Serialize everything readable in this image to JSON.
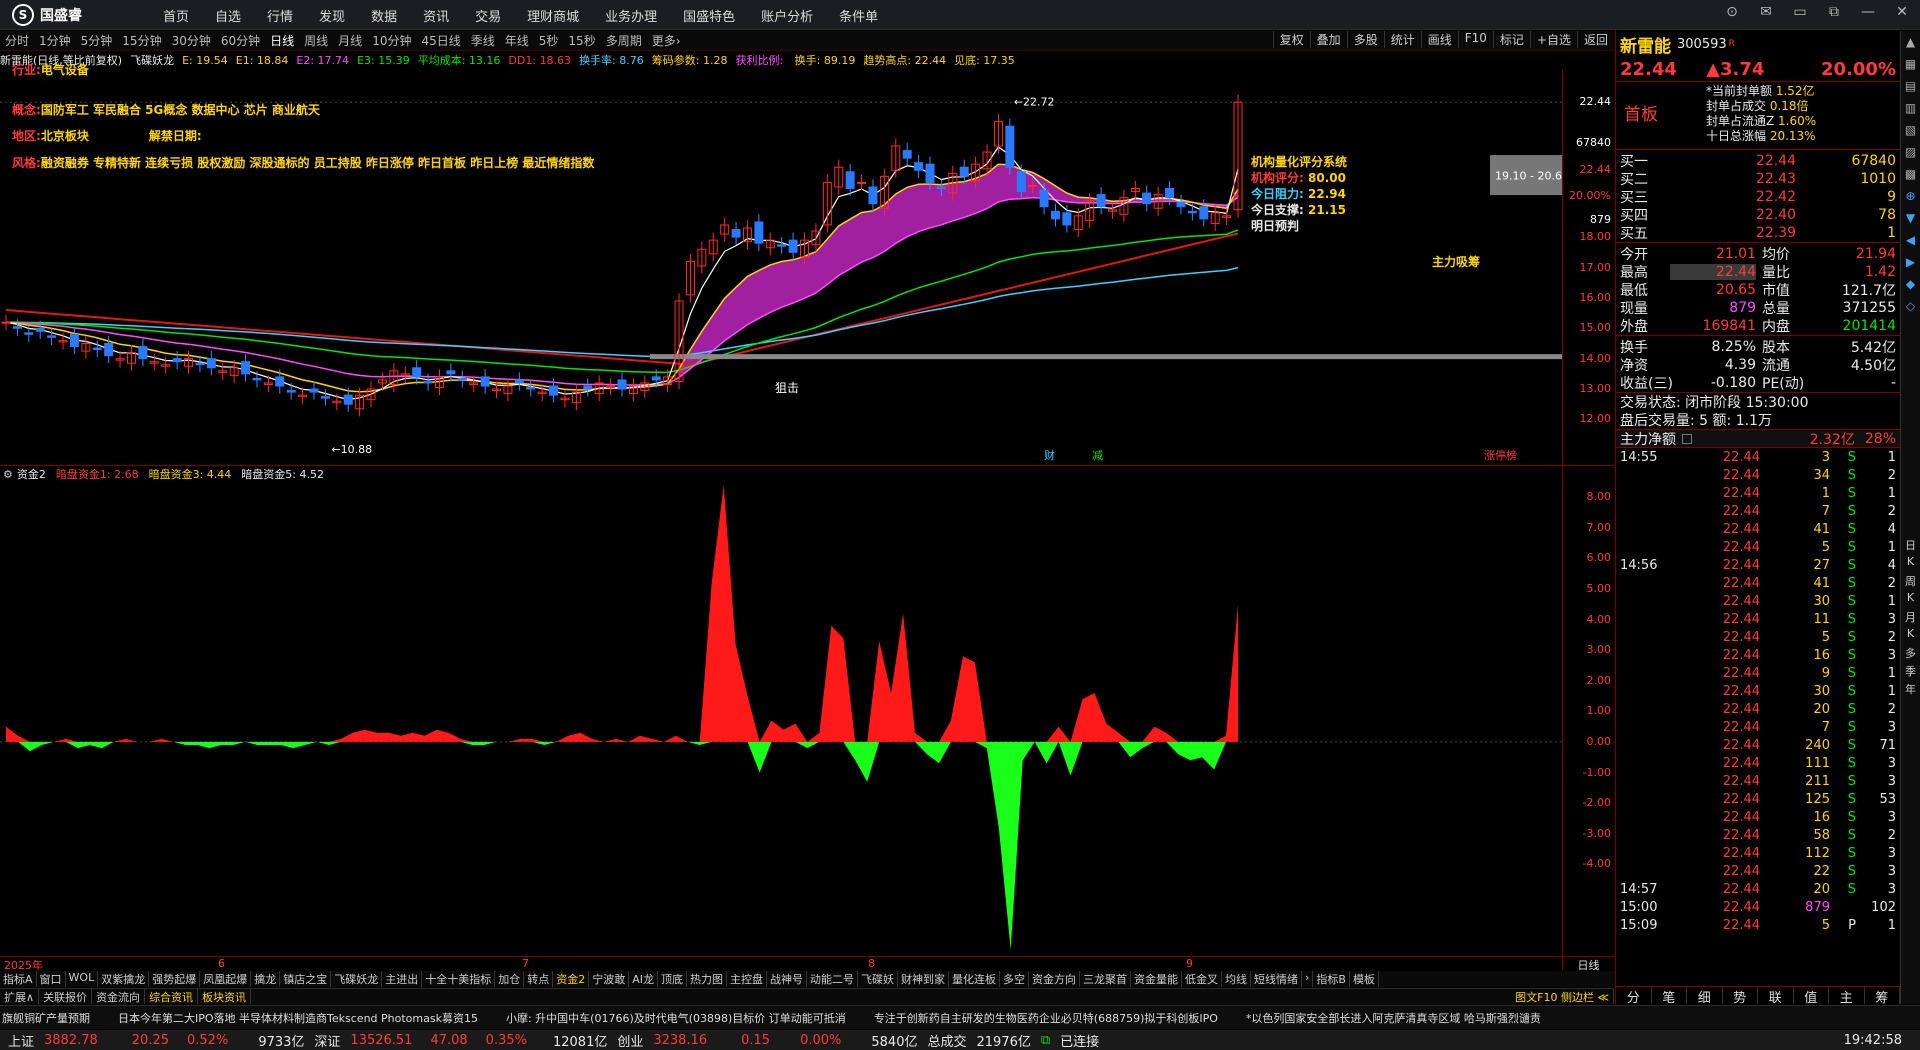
{
  "app": {
    "logo_text": "国盛睿"
  },
  "nav": [
    "首页",
    "自选",
    "行情",
    "发现",
    "数据",
    "资讯",
    "交易",
    "理财商城",
    "业务办理",
    "国盛特色",
    "账户分析",
    "条件单"
  ],
  "window_buttons": [
    "⊙",
    "✉",
    "▭",
    "⧉",
    "—",
    "✕"
  ],
  "periods": [
    "分时",
    "1分钟",
    "5分钟",
    "15分钟",
    "30分钟",
    "60分钟",
    "日线",
    "周线",
    "月线",
    "10分钟",
    "45日线",
    "季线",
    "年线",
    "5秒",
    "15秒",
    "多周期",
    "更多›"
  ],
  "active_period": "日线",
  "toolbar_right": [
    "复权",
    "叠加",
    "多股",
    "统计",
    "画线",
    "F10",
    "标记",
    "+自选",
    "返回"
  ],
  "indicator_header": [
    {
      "t": "新雷能(日线,等比前复权)",
      "c": "#e8e8e8"
    },
    {
      "t": "飞碟妖龙",
      "c": "#e8e8e8"
    },
    {
      "t": "E: 19.54",
      "c": "#ffd400"
    },
    {
      "t": "E1: 18.84",
      "c": "#ffd400"
    },
    {
      "t": "E2: 17.74",
      "c": "#ff4dff"
    },
    {
      "t": "E3: 15.39",
      "c": "#00e600"
    },
    {
      "t": "平均成本: 13.16",
      "c": "#00e600"
    },
    {
      "t": "DD1: 18.63",
      "c": "#ff3b3b"
    },
    {
      "t": "换手率: 8.76",
      "c": "#40d0ff"
    },
    {
      "t": "筹码参数: 1.28",
      "c": "#ffd400"
    },
    {
      "t": "获利比例: ",
      "c": "#ff4dff"
    },
    {
      "t": "换手: 89.19",
      "c": "#ffd400"
    },
    {
      "t": "趋势高点: 22.44",
      "c": "#ffd400"
    },
    {
      "t": "见底: 17.35",
      "c": "#ffd400"
    }
  ],
  "info_lines": [
    {
      "k": "行业:",
      "v": "电气设备"
    },
    {
      "k": "概念:",
      "v": "国防军工 军民融合 5G概念 数据中心 芯片 商业航天"
    },
    {
      "k": "地区:",
      "v": "北京板块",
      "k2": "解禁日期:",
      "v2": ""
    },
    {
      "k": "风格:",
      "v": "融资融券 专精特新 连续亏损 股权激励 深股通标的 员工持股 昨日涨停 昨日首板 昨日上榜 最近情绪指数"
    }
  ],
  "score_box": {
    "title": "机构量化评分系统",
    "rows": [
      {
        "k": "机构评分:",
        "v": "80.00"
      },
      {
        "k": "今日阻力:",
        "v": "22.94"
      },
      {
        "k": "今日支撑:",
        "v": "21.15"
      },
      {
        "k": "明日预判",
        "v": ""
      }
    ]
  },
  "chart_labels": {
    "high": "22.72",
    "low": "10.88",
    "range": "19.10 - 20.6",
    "main_buy": "主力吸筹",
    "strike": "狙击",
    "bottom_tags": [
      "财",
      "减",
      "涨停榜"
    ]
  },
  "price_axis": [
    "22.44",
    "67840",
    "22.44",
    "20.00%",
    "879",
    "18.00",
    "17.00",
    "16.00",
    "15.00",
    "14.00",
    "13.00",
    "12.00"
  ],
  "sub_header": [
    {
      "t": "资金2",
      "c": "#e8e8e8"
    },
    {
      "t": "暗盘资金1: 2.68",
      "c": "#ff3b3b"
    },
    {
      "t": "暗盘资金3: 4.44",
      "c": "#ffd400"
    },
    {
      "t": "暗盘资金5: 4.52",
      "c": "#e8e8e8"
    }
  ],
  "sub_axis": [
    "8.00",
    "7.00",
    "6.00",
    "5.00",
    "4.00",
    "3.00",
    "2.00",
    "1.00",
    "0.00",
    "-1.00",
    "-2.00",
    "-3.00",
    "-4.00"
  ],
  "dates": [
    "2025年",
    "6",
    "7",
    "8",
    "9"
  ],
  "right_bottom_label": "日线",
  "indicator_tabs": [
    "指标A",
    "窗口",
    "WOL",
    "双紫擒龙",
    "强势起爆",
    "凤凰起爆",
    "擒龙",
    "镇店之宝",
    "飞碟妖龙",
    "主进出",
    "十全十美指标",
    "加仓",
    "转点",
    "资金2",
    "宁波敢",
    "AI龙",
    "顶底",
    "热力图",
    "主控盘",
    "战神号",
    "动能二号",
    "飞碟妖",
    "财神到家",
    "量化连板",
    "多空",
    "资金方向",
    "三龙聚首",
    "资金量能",
    "低金叉",
    "均线",
    "短线情绪",
    "›",
    "指标B",
    "模板"
  ],
  "active_tab": "资金2",
  "sub_tabs": [
    "扩展∧",
    "关联报价",
    "资金流向",
    "综合资讯",
    "板块资讯"
  ],
  "sub_tabs_right": "图文F10 侧边栏 ≪",
  "ticker": [
    "旗舰铜矿产量预期",
    "日本今年第二大IPO落地 半导体材料制造商Tekscend Photomask募资15",
    "小摩: 升中国中车(01766)及时代电气(03898)目标价 订单动能可抵消",
    "专注于创新药自主研发的生物医药企业必贝特(688759)拟于科创板IPO",
    "*以色列国家安全部长进入阿克萨清真寺区域 哈马斯强烈谴责"
  ],
  "status": {
    "sh_label": "上证",
    "sh": "3882.78",
    "sh_chg": "20.25",
    "sh_pct": "0.52%",
    "sh_amt": "9733亿",
    "sz_label": "深证",
    "sz": "13526.51",
    "sz_chg": "47.08",
    "sz_pct": "0.35%",
    "sz_amt": "12081亿",
    "cy_label": "创业",
    "cy": "3238.16",
    "cy_chg": "0.15",
    "cy_pct": "0.00%",
    "cy_amt": "5840亿",
    "total_label": "总成交",
    "total": "21976亿",
    "conn": "已连接",
    "time": "19:42:58"
  },
  "quote": {
    "name": "新雷能",
    "code": "300593",
    "badge": "R",
    "price": "22.44",
    "change": "▲3.74",
    "pct": "20.00%",
    "board": "首板",
    "seal_rows": [
      {
        "k": "*当前封单额",
        "v": "1.52亿"
      },
      {
        "k": "封单占成交",
        "v": "0.18倍"
      },
      {
        "k": "封单占流通Z",
        "v": "1.60%"
      },
      {
        "k": "十日总涨幅",
        "v": "20.13%"
      }
    ],
    "bids": [
      {
        "k": "买一",
        "p": "22.44",
        "v": "67840"
      },
      {
        "k": "买二",
        "p": "22.43",
        "v": "1010"
      },
      {
        "k": "买三",
        "p": "22.42",
        "v": "9"
      },
      {
        "k": "买四",
        "p": "22.40",
        "v": "78"
      },
      {
        "k": "买五",
        "p": "22.39",
        "v": "1"
      }
    ],
    "stats": [
      {
        "k1": "今开",
        "v1": "21.01",
        "c1": "red",
        "k2": "均价",
        "v2": "21.94",
        "c2": "red"
      },
      {
        "k1": "最高",
        "v1": "22.44",
        "c1": "red",
        "k2": "量比",
        "v2": "1.42",
        "c2": "red"
      },
      {
        "k1": "最低",
        "v1": "20.65",
        "c1": "red",
        "k2": "市值",
        "v2": "121.7亿",
        "c2": "wht"
      },
      {
        "k1": "现量",
        "v1": "879",
        "c1": "mag",
        "k2": "总量",
        "v2": "371255",
        "c2": "wht"
      },
      {
        "k1": "外盘",
        "v1": "169841",
        "c1": "red",
        "k2": "内盘",
        "v2": "201414",
        "c2": "grn"
      }
    ],
    "stats2": [
      {
        "k1": "换手",
        "v1": "8.25%",
        "k2": "股本",
        "v2": "5.42亿"
      },
      {
        "k1": "净资",
        "v1": "4.39",
        "k2": "流通",
        "v2": "4.50亿"
      },
      {
        "k1": "收益(三)",
        "v1": "-0.180",
        "k2": "PE(动)",
        "v2": "-"
      }
    ],
    "trade_status": "交易状态: 闭市阶段 15:30:00",
    "after_hours": "盘后交易量: 5  额: 1.1万",
    "net_label": "主力净额",
    "net_value": "2.32亿",
    "net_pct": "28%"
  },
  "ticks": [
    {
      "t": "14:55",
      "p": "22.44",
      "v": "3",
      "c": "S",
      "n": "1"
    },
    {
      "t": "",
      "p": "22.44",
      "v": "34",
      "c": "S",
      "n": "2"
    },
    {
      "t": "",
      "p": "22.44",
      "v": "1",
      "c": "S",
      "n": "1"
    },
    {
      "t": "",
      "p": "22.44",
      "v": "7",
      "c": "S",
      "n": "2"
    },
    {
      "t": "",
      "p": "22.44",
      "v": "41",
      "c": "S",
      "n": "4"
    },
    {
      "t": "",
      "p": "22.44",
      "v": "5",
      "c": "S",
      "n": "1"
    },
    {
      "t": "14:56",
      "p": "22.44",
      "v": "27",
      "c": "S",
      "n": "4"
    },
    {
      "t": "",
      "p": "22.44",
      "v": "41",
      "c": "S",
      "n": "2"
    },
    {
      "t": "",
      "p": "22.44",
      "v": "30",
      "c": "S",
      "n": "1"
    },
    {
      "t": "",
      "p": "22.44",
      "v": "11",
      "c": "S",
      "n": "3"
    },
    {
      "t": "",
      "p": "22.44",
      "v": "5",
      "c": "S",
      "n": "2"
    },
    {
      "t": "",
      "p": "22.44",
      "v": "16",
      "c": "S",
      "n": "3"
    },
    {
      "t": "",
      "p": "22.44",
      "v": "9",
      "c": "S",
      "n": "1"
    },
    {
      "t": "",
      "p": "22.44",
      "v": "30",
      "c": "S",
      "n": "1"
    },
    {
      "t": "",
      "p": "22.44",
      "v": "20",
      "c": "S",
      "n": "2"
    },
    {
      "t": "",
      "p": "22.44",
      "v": "7",
      "c": "S",
      "n": "3"
    },
    {
      "t": "",
      "p": "22.44",
      "v": "240",
      "c": "S",
      "n": "71"
    },
    {
      "t": "",
      "p": "22.44",
      "v": "111",
      "c": "S",
      "n": "3"
    },
    {
      "t": "",
      "p": "22.44",
      "v": "211",
      "c": "S",
      "n": "3"
    },
    {
      "t": "",
      "p": "22.44",
      "v": "125",
      "c": "S",
      "n": "53"
    },
    {
      "t": "",
      "p": "22.44",
      "v": "16",
      "c": "S",
      "n": "3"
    },
    {
      "t": "",
      "p": "22.44",
      "v": "58",
      "c": "S",
      "n": "2"
    },
    {
      "t": "",
      "p": "22.44",
      "v": "112",
      "c": "S",
      "n": "3"
    },
    {
      "t": "",
      "p": "22.44",
      "v": "22",
      "c": "S",
      "n": "3"
    },
    {
      "t": "14:57",
      "p": "22.44",
      "v": "20",
      "c": "S",
      "n": "3"
    },
    {
      "t": "15:00",
      "p": "22.44",
      "v": "879",
      "c": "",
      "n": "102"
    },
    {
      "t": "15:09",
      "p": "22.44",
      "v": "5",
      "c": "P",
      "n": "1"
    }
  ],
  "bottom_tabs": [
    "分",
    "笔",
    "细",
    "势",
    "联",
    "值",
    "主",
    "筹"
  ],
  "sidebar_tools": [
    "▲",
    "▦",
    "▤",
    "▥",
    "▧",
    "▨",
    "▩",
    "⊕",
    "▼",
    "◀",
    "▶",
    "◆",
    "◇"
  ],
  "sidebar_text": [
    "日",
    "K",
    "周",
    "K",
    "月",
    "K",
    "多",
    "季",
    "年"
  ],
  "chart_data": {
    "type": "candlestick",
    "price_ylim": [
      10.5,
      23.5
    ],
    "close": [
      15.2,
      15.0,
      14.8,
      14.9,
      14.7,
      14.6,
      14.4,
      14.5,
      14.3,
      14.1,
      14.0,
      14.2,
      14.0,
      13.9,
      13.8,
      13.9,
      14.0,
      13.8,
      13.7,
      13.6,
      13.7,
      13.5,
      13.3,
      13.2,
      13.1,
      12.9,
      12.8,
      12.9,
      12.7,
      12.6,
      12.5,
      12.8,
      13.0,
      13.3,
      13.6,
      13.5,
      13.4,
      13.2,
      13.4,
      13.5,
      13.3,
      13.2,
      13.1,
      13.0,
      13.1,
      13.2,
      13.0,
      12.9,
      12.8,
      12.7,
      12.9,
      13.0,
      13.2,
      13.1,
      13.0,
      13.1,
      13.2,
      13.3,
      13.4,
      15.9,
      17.2,
      17.6,
      17.9,
      18.4,
      18.0,
      18.3,
      17.8,
      17.9,
      17.7,
      17.5,
      17.9,
      18.2,
      19.8,
      20.3,
      19.6,
      19.8,
      19.1,
      20.0,
      21.0,
      20.6,
      20.2,
      19.8,
      19.6,
      20.1,
      20.0,
      20.4,
      20.8,
      21.8,
      20.3,
      19.5,
      19.7,
      19.0,
      18.6,
      18.4,
      18.7,
      19.2,
      19.0,
      18.9,
      19.3,
      19.6,
      19.1,
      19.4,
      19.3,
      19.0,
      18.8,
      18.6,
      18.8,
      18.7,
      22.44
    ],
    "series_lines": [
      {
        "name": "E",
        "color": "#ffffff"
      },
      {
        "name": "E1",
        "color": "#ffd400"
      },
      {
        "name": "E2",
        "color": "#ff4dff"
      },
      {
        "name": "E3",
        "color": "#00e600"
      },
      {
        "name": "平均成本",
        "color": "#40d0ff"
      },
      {
        "name": "DD1",
        "color": "#ff2020"
      }
    ],
    "sub_ylim": [
      -7,
      8.5
    ],
    "sub_values": [
      0.5,
      0.2,
      -0.3,
      -0.1,
      0.0,
      0.1,
      -0.2,
      -0.1,
      -0.2,
      0.0,
      0.1,
      0.0,
      0.0,
      0.1,
      0.0,
      -0.1,
      -0.1,
      -0.2,
      -0.1,
      -0.1,
      0.0,
      -0.1,
      -0.1,
      -0.1,
      -0.2,
      -0.1,
      0.0,
      -0.1,
      0.1,
      0.3,
      0.4,
      0.3,
      0.3,
      0.2,
      0.3,
      0.2,
      0.4,
      0.3,
      0.1,
      -0.1,
      -0.1,
      0.0,
      0.0,
      0.1,
      0.1,
      -0.1,
      0.0,
      0.2,
      0.3,
      0.1,
      0.0,
      0.1,
      0.0,
      0.2,
      0.1,
      0.0,
      0.2,
      0.0,
      -0.1,
      5.2,
      8.4,
      3.2,
      1.5,
      -1.0,
      0.7,
      0.4,
      0.6,
      -0.2,
      0.3,
      3.8,
      3.4,
      -0.6,
      -1.3,
      3.3,
      1.6,
      4.2,
      0.3,
      -0.4,
      -0.7,
      0.7,
      2.8,
      2.6,
      -0.2,
      -2.8,
      -6.8,
      -0.6,
      0.0,
      -0.7,
      0.5,
      -1.1,
      1.4,
      1.6,
      0.6,
      0.3,
      -0.5,
      -0.2,
      0.5,
      0.3,
      -0.4,
      -0.6,
      -0.5,
      -0.9,
      0.2,
      4.5
    ]
  }
}
